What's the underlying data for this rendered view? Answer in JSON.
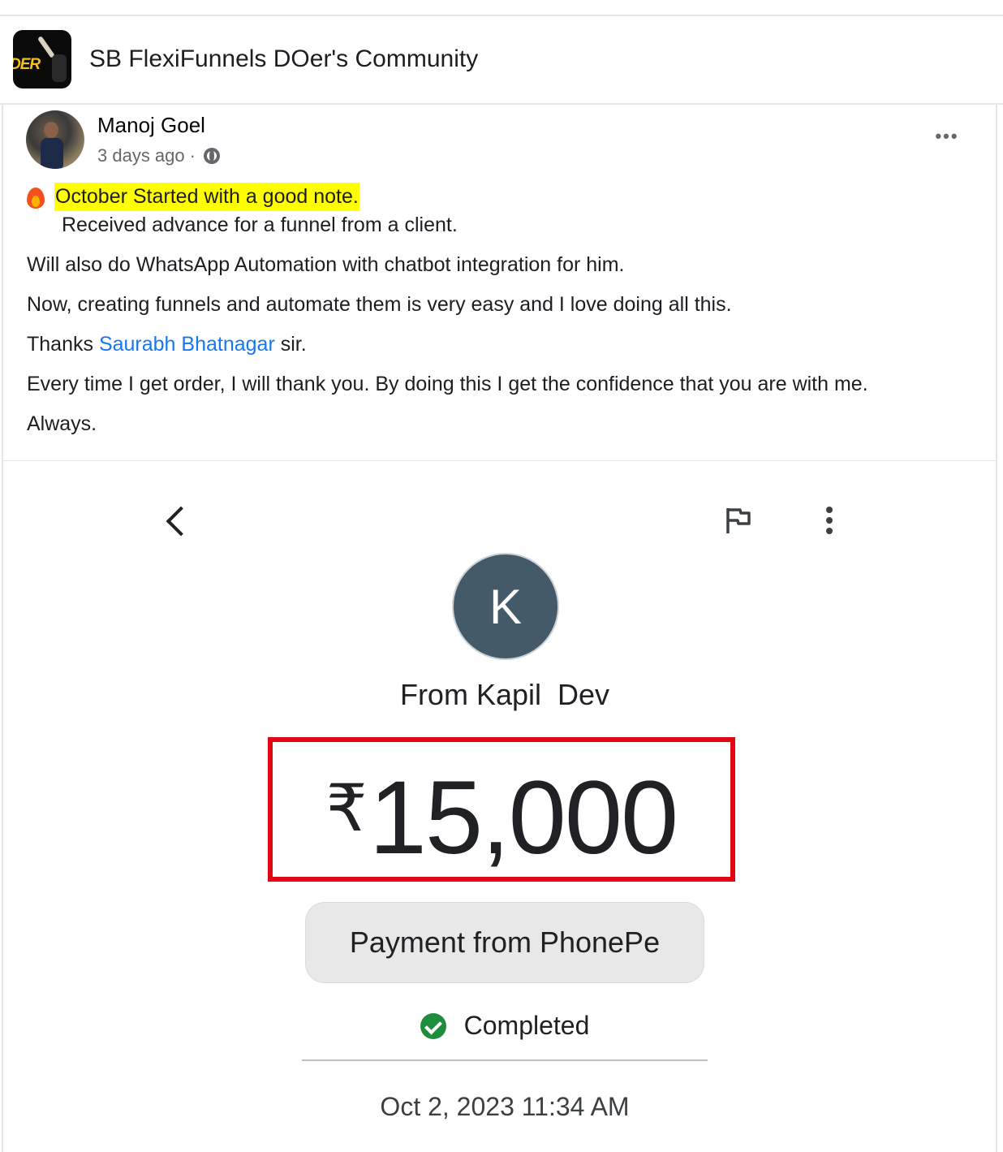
{
  "group": {
    "name": "SB FlexiFunnels DOer's Community",
    "logo_text": "DER"
  },
  "post": {
    "author": "Manoj Goel",
    "time": "3 days ago",
    "separator": "·",
    "highlighted": "October Started with a good note.",
    "line2": "Received advance for a funnel from a client.",
    "para1": "Will also do WhatsApp Automation with chatbot integration for him.",
    "para2": "Now, creating funnels and automate them is very easy and I love doing all this.",
    "thanks_prefix": "Thanks ",
    "mention": "Saurabh Bhatnagar",
    "thanks_suffix": " sir.",
    "para4": "Every time I get order, I will thank you. By doing this I get the confidence that you are with me.",
    "para5": "Always."
  },
  "payment": {
    "avatar_letter": "K",
    "from": "From Kapil  Dev",
    "currency": "₹",
    "amount": "15,000",
    "source": "Payment from PhonePe",
    "status": "Completed",
    "date": "Oct 2, 2023 11:34 AM"
  },
  "colors": {
    "mention": "#1877f2",
    "highlight": "#ffff00",
    "amount_border": "#e30613",
    "avatar_bg": "#445a68",
    "status_green": "#1e8e3e"
  }
}
